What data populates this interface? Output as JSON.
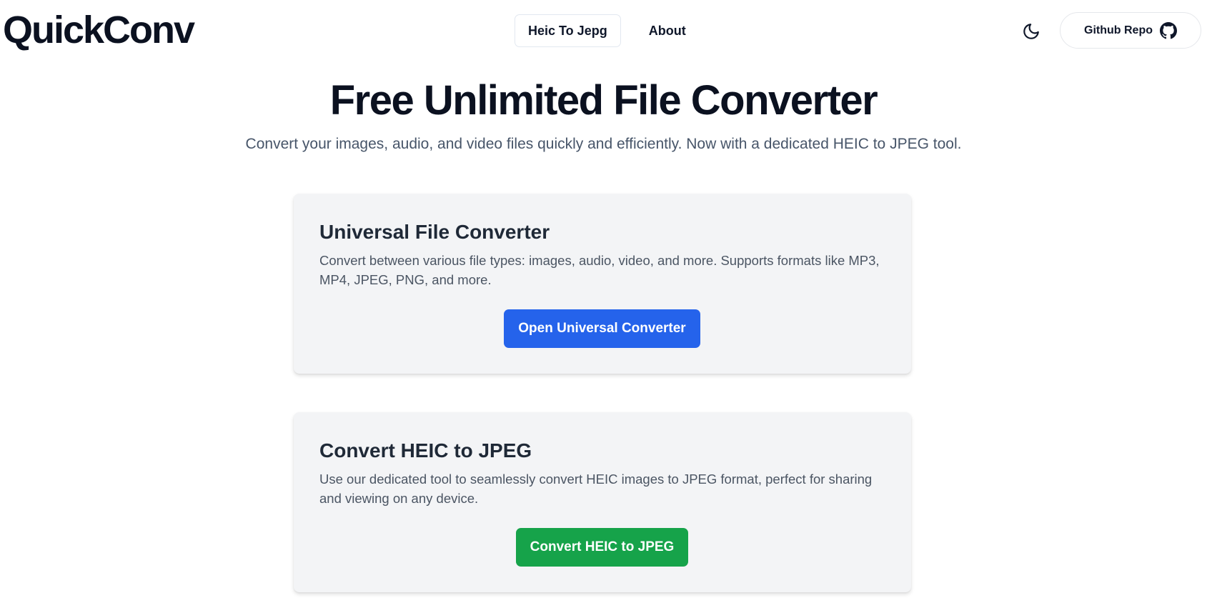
{
  "header": {
    "logo": "QuickConv",
    "nav": [
      {
        "label": "Heic To Jepg",
        "active": true
      },
      {
        "label": "About",
        "active": false
      }
    ],
    "theme_toggle_icon": "moon-icon",
    "github_button": {
      "label": "Github Repo",
      "icon": "github-icon"
    }
  },
  "hero": {
    "title": "Free Unlimited File Converter",
    "subtitle": "Convert your images, audio, and video files quickly and efficiently. Now with a dedicated HEIC to JPEG tool."
  },
  "cards": [
    {
      "title": "Universal File Converter",
      "description": "Convert between various file types: images, audio, video, and more. Supports formats like MP3, MP4, JPEG, PNG, and more.",
      "button_label": "Open Universal Converter",
      "button_color": "#2563eb"
    },
    {
      "title": "Convert HEIC to JPEG",
      "description": "Use our dedicated tool to seamlessly convert HEIC images to JPEG format, perfect for sharing and viewing on any device.",
      "button_label": "Convert HEIC to JPEG",
      "button_color": "#16a34a"
    }
  ]
}
